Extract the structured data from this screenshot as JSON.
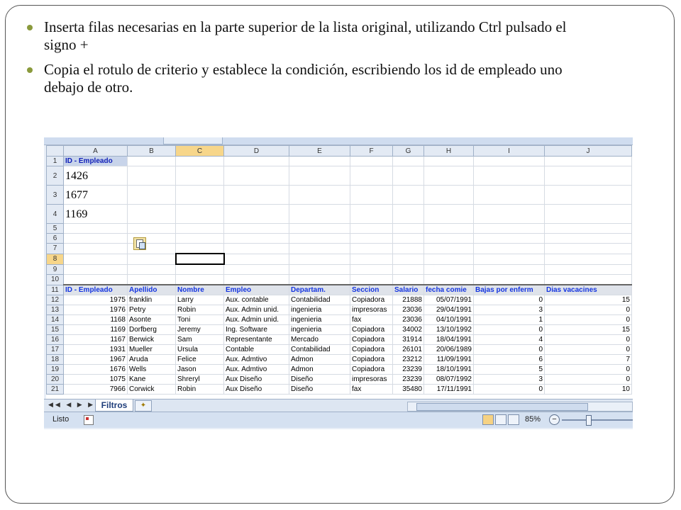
{
  "bullets": [
    "Inserta filas necesarias en la parte superior de la lista original, utilizando Ctrl pulsado el signo +",
    "Copia el rotulo de criterio y establece la condición, escribiendo  los id de empleado uno debajo de otro."
  ],
  "excel": {
    "columns": [
      "A",
      "B",
      "C",
      "D",
      "E",
      "F",
      "G",
      "H",
      "I",
      "J"
    ],
    "criteria": {
      "header": "ID - Empleado",
      "values": [
        "1426",
        "1677",
        "1169"
      ]
    },
    "table_headers": [
      "ID - Empleado",
      "Apellido",
      "Nombre",
      "Empleo",
      "Departam.",
      "Seccion",
      "Salario",
      "fecha comie",
      "Bajas por enferm",
      "Dias vacacines"
    ],
    "rows": [
      {
        "num": "12",
        "cells": [
          "1975",
          "franklin",
          "Larry",
          "Aux. contable",
          "Contabilidad",
          "Copiadora",
          "21888",
          "05/07/1991",
          "0",
          "15"
        ]
      },
      {
        "num": "13",
        "cells": [
          "1976",
          "Petry",
          "Robin",
          "Aux. Admin unid.",
          "ingenieria",
          "impresoras",
          "23036",
          "29/04/1991",
          "3",
          "0"
        ]
      },
      {
        "num": "14",
        "cells": [
          "1168",
          "Asonte",
          "Toni",
          "Aux. Admin unid.",
          "ingenieria",
          "fax",
          "23036",
          "04/10/1991",
          "1",
          "0"
        ]
      },
      {
        "num": "15",
        "cells": [
          "1169",
          "Dorfberg",
          "Jeremy",
          "Ing. Software",
          "ingenieria",
          "Copiadora",
          "34002",
          "13/10/1992",
          "0",
          "15"
        ]
      },
      {
        "num": "16",
        "cells": [
          "1167",
          "Berwick",
          "Sam",
          "Representante",
          "Mercado",
          "Copiadora",
          "31914",
          "18/04/1991",
          "4",
          "0"
        ]
      },
      {
        "num": "17",
        "cells": [
          "1931",
          "Mueller",
          "Ursula",
          "Contable",
          "Contabilidad",
          "Copiadora",
          "26101",
          "20/06/1989",
          "0",
          "0"
        ]
      },
      {
        "num": "18",
        "cells": [
          "1967",
          "Aruda",
          "Felice",
          "Aux. Admtivo",
          "Admon",
          "Copiadora",
          "23212",
          "11/09/1991",
          "6",
          "7"
        ]
      },
      {
        "num": "19",
        "cells": [
          "1676",
          "Wells",
          "Jason",
          "Aux. Admtivo",
          "Admon",
          "Copiadora",
          "23239",
          "18/10/1991",
          "5",
          "0"
        ]
      },
      {
        "num": "20",
        "cells": [
          "1075",
          "Kane",
          "Shreryl",
          "Aux Diseño",
          "Diseño",
          "impresoras",
          "23239",
          "08/07/1992",
          "3",
          "0"
        ]
      },
      {
        "num": "21",
        "cells": [
          "7966",
          "Corwick",
          "Robin",
          "Aux Diseño",
          "Diseño",
          "fax",
          "35480",
          "17/11/1991",
          "0",
          "10"
        ]
      }
    ],
    "sheet_tab": "Filtros",
    "status": "Listo",
    "zoom": "85%"
  }
}
